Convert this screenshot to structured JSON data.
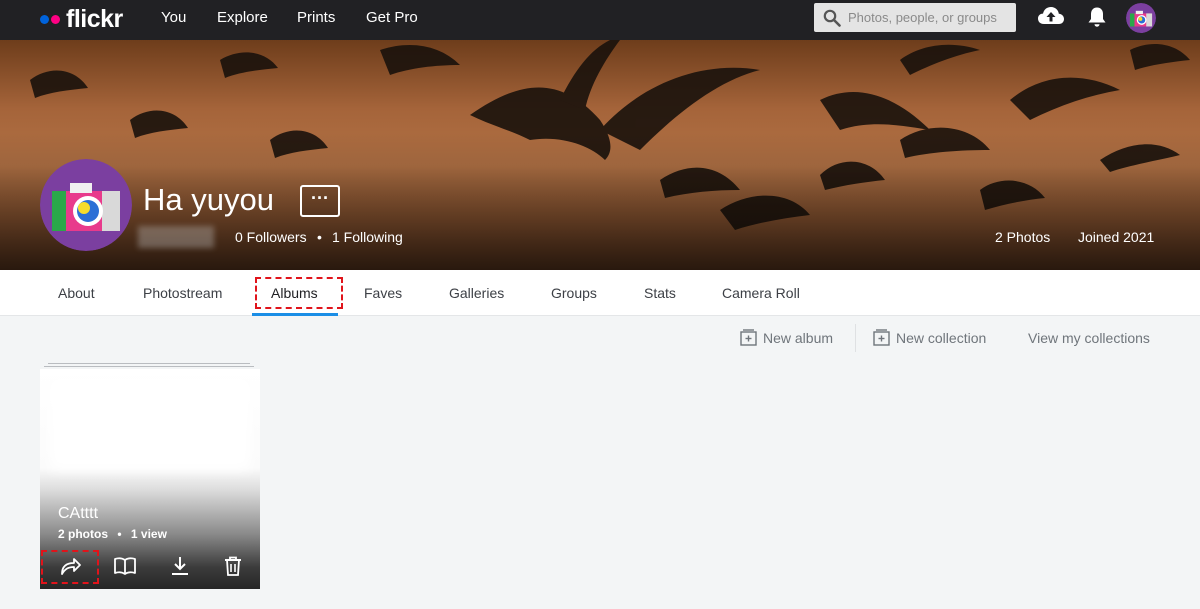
{
  "brand": {
    "name": "flickr"
  },
  "nav": {
    "items": [
      "You",
      "Explore",
      "Prints",
      "Get Pro"
    ]
  },
  "search": {
    "placeholder": "Photos, people, or groups"
  },
  "icons": {
    "search": "search-icon",
    "upload": "cloud-upload-icon",
    "notifications": "bell-icon",
    "more": "ellipsis-icon",
    "new_album": "add-album-icon",
    "new_collection": "add-collection-icon",
    "share": "share-arrow-icon",
    "open_book": "book-icon",
    "download": "download-icon",
    "delete": "trash-icon"
  },
  "profile": {
    "username": "Ha yuyou",
    "more_label": "···",
    "followers": "0 Followers",
    "following": "1 Following",
    "separator": "•",
    "photos": "2 Photos",
    "joined": "Joined 2021"
  },
  "tabs": [
    {
      "label": "About"
    },
    {
      "label": "Photostream"
    },
    {
      "label": "Albums"
    },
    {
      "label": "Faves"
    },
    {
      "label": "Galleries"
    },
    {
      "label": "Groups"
    },
    {
      "label": "Stats"
    },
    {
      "label": "Camera Roll"
    }
  ],
  "active_tab": "Albums",
  "actions": {
    "new_album": "New album",
    "new_collection": "New collection",
    "view_collections": "View my collections"
  },
  "album": {
    "title": "CAtttt",
    "photos": "2 photos",
    "separator": "•",
    "views": "1 view"
  },
  "colors": {
    "topbar": "#212124",
    "flickr_blue": "#0063dc",
    "flickr_pink": "#ff0084",
    "active_tab_underline": "#1b8ee6",
    "highlight_dash": "#e0141b",
    "avatar_purple": "#7b3fa0"
  }
}
